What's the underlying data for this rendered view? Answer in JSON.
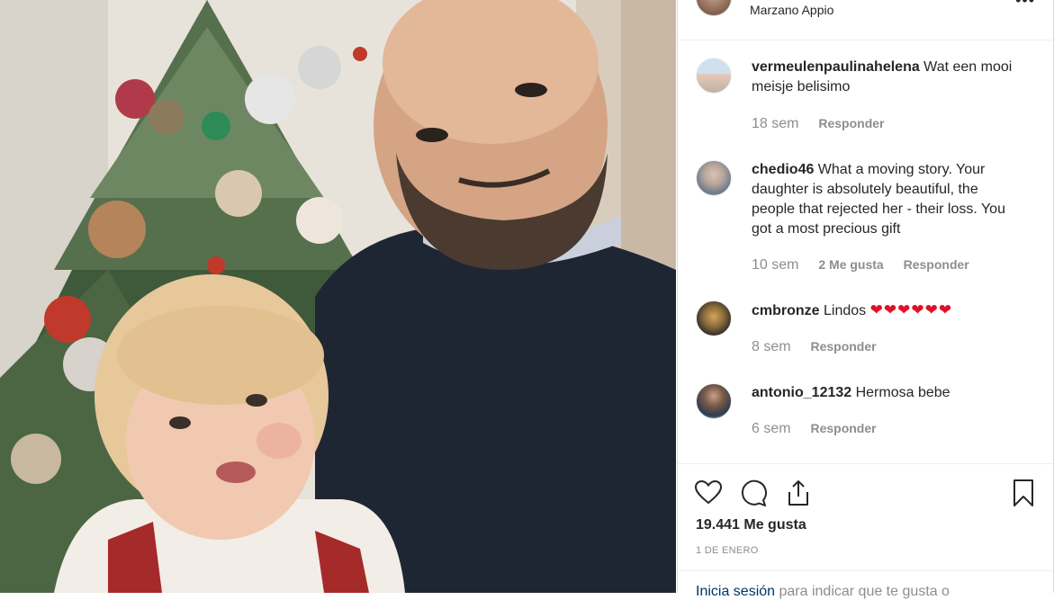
{
  "post": {
    "location": "Marzano Appio",
    "more_label": "•••"
  },
  "comments": [
    {
      "username": "vermeulenpaulinahelena",
      "text": " Wat een mooi meisje belisimo",
      "time": "18 sem",
      "likes": "",
      "reply": "Responder"
    },
    {
      "username": "chedio46",
      "text": " What a moving story. Your daughter is absolutely beautiful, the people that rejected her - their loss. You got a most precious gift",
      "time": "10 sem",
      "likes": "2 Me gusta",
      "reply": "Responder"
    },
    {
      "username": "cmbronze",
      "text": " Lindos ",
      "hearts": "❤❤❤❤❤❤",
      "time": "8 sem",
      "likes": "",
      "reply": "Responder"
    },
    {
      "username": "antonio_12132",
      "text": " Hermosa bebe",
      "time": "6 sem",
      "likes": "",
      "reply": "Responder"
    }
  ],
  "actions": {
    "likes_count": "19.441 Me gusta",
    "date": "1 DE ENERO",
    "login_link": "Inicia sesión",
    "login_text": " para indicar que te gusta o"
  },
  "icons": [
    "heart-icon",
    "comment-icon",
    "share-icon",
    "bookmark-icon"
  ]
}
